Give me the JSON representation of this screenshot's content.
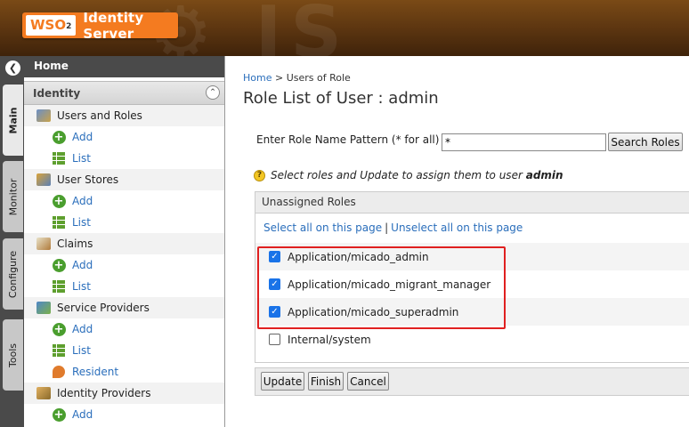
{
  "header": {
    "logo_brand": "WSO2",
    "logo_product": "Identity Server"
  },
  "vtabs": [
    "Main",
    "Monitor",
    "Configure",
    "Tools"
  ],
  "menu": {
    "home": "Home",
    "section": "Identity",
    "items": [
      {
        "label": "Users and Roles",
        "kind": "group",
        "icon": "users-icon"
      },
      {
        "label": "Add",
        "kind": "child",
        "icon": "add-icon"
      },
      {
        "label": "List",
        "kind": "child",
        "icon": "list-icon"
      },
      {
        "label": "User Stores",
        "kind": "group",
        "icon": "user-stores-icon"
      },
      {
        "label": "Add",
        "kind": "child",
        "icon": "add-icon"
      },
      {
        "label": "List",
        "kind": "child",
        "icon": "list-icon"
      },
      {
        "label": "Claims",
        "kind": "group",
        "icon": "claims-icon"
      },
      {
        "label": "Add",
        "kind": "child",
        "icon": "add-icon"
      },
      {
        "label": "List",
        "kind": "child",
        "icon": "list-icon"
      },
      {
        "label": "Service Providers",
        "kind": "group",
        "icon": "service-providers-icon"
      },
      {
        "label": "Add",
        "kind": "child",
        "icon": "add-icon"
      },
      {
        "label": "List",
        "kind": "child",
        "icon": "list-icon"
      },
      {
        "label": "Resident",
        "kind": "child",
        "icon": "resident-icon"
      },
      {
        "label": "Identity Providers",
        "kind": "group",
        "icon": "identity-providers-icon"
      },
      {
        "label": "Add",
        "kind": "child",
        "icon": "add-icon"
      }
    ]
  },
  "breadcrumb": {
    "home": "Home",
    "sep": " > ",
    "current": "Users of Role"
  },
  "page_title": "Role List of User : admin",
  "search": {
    "label": "Enter Role Name Pattern (* for all)",
    "value": "*",
    "button": "Search Roles"
  },
  "hint": {
    "text": "Select roles and Update to assign them to user ",
    "user": "admin"
  },
  "roles": {
    "header": "Unassigned Roles",
    "select_all": "Select all on this page",
    "separator": "|",
    "unselect_all": "Unselect all on this page",
    "items": [
      {
        "name": "Application/micado_admin",
        "checked": true
      },
      {
        "name": "Application/micado_migrant_manager",
        "checked": true
      },
      {
        "name": "Application/micado_superadmin",
        "checked": true
      },
      {
        "name": "Internal/system",
        "checked": false
      }
    ]
  },
  "actions": {
    "update": "Update",
    "finish": "Finish",
    "cancel": "Cancel"
  },
  "colors": {
    "accent": "#f47b20",
    "link": "#2a6ebb",
    "highlight": "#e02020",
    "checkbox": "#1a73e8"
  }
}
